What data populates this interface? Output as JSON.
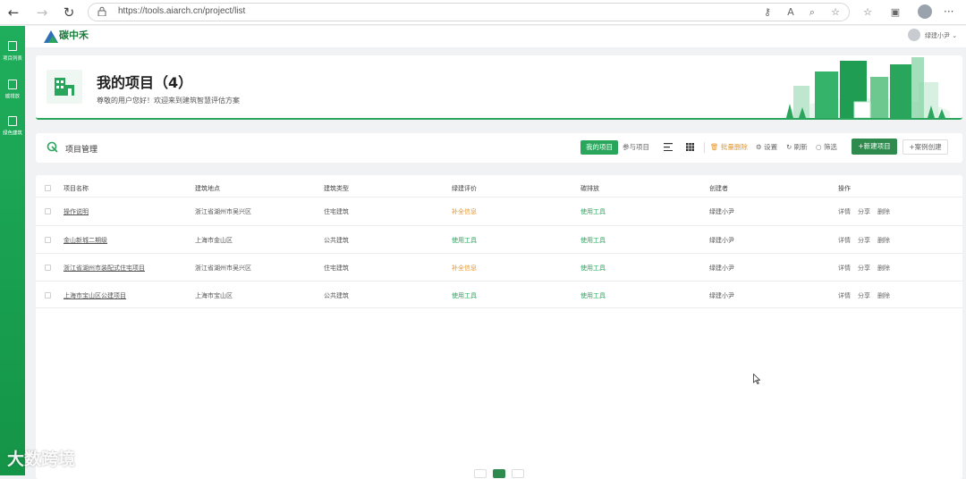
{
  "browser": {
    "url": "https://tools.aiarch.cn/project/list"
  },
  "sidebar": {
    "items": [
      {
        "label": "项目列表"
      },
      {
        "label": "碳排放"
      },
      {
        "label": "绿色建筑"
      }
    ]
  },
  "header": {
    "logo_text": "碳中禾",
    "user_name": "绿建小尹 ⌄"
  },
  "banner": {
    "title": "我的项目（4）",
    "subtitle": "尊敬的用户您好！欢迎来到建筑智慧评估方案"
  },
  "toolbar": {
    "title": "项目管理",
    "tab_mine": "我的项目",
    "tab_joined": "参与项目",
    "batch_delete": "批量删除",
    "settings": "设置",
    "refresh": "刷新",
    "filter": "筛选",
    "new_project": "+新建项目",
    "case_create": "+案例创建"
  },
  "table": {
    "headers": [
      "项目名称",
      "建筑地点",
      "建筑类型",
      "绿建评价",
      "碳排放",
      "创建者",
      "操作"
    ],
    "rows": [
      {
        "name": "操作说明",
        "location": "浙江省湖州市吴兴区",
        "type": "住宅建筑",
        "green": "补全信息",
        "carbon": "使用工具",
        "creator": "绿建小尹"
      },
      {
        "name": "金山新城二期级",
        "location": "上海市金山区",
        "type": "公共建筑",
        "green": "使用工具",
        "carbon": "使用工具",
        "creator": "绿建小尹"
      },
      {
        "name": "浙江省湖州市装配式住宅项目",
        "location": "浙江省湖州市吴兴区",
        "type": "住宅建筑",
        "green": "补全信息",
        "carbon": "使用工具",
        "creator": "绿建小尹"
      },
      {
        "name": "上海市宝山区公建项目",
        "location": "上海市宝山区",
        "type": "公共建筑",
        "green": "使用工具",
        "carbon": "使用工具",
        "creator": "绿建小尹"
      }
    ],
    "ops": {
      "detail": "详情",
      "share": "分享",
      "delete": "删除"
    }
  },
  "watermark": "大数跨境",
  "colors": {
    "accent": "#2aa55c",
    "accent_dark": "#2f8a4e",
    "warning": "#e8962b"
  }
}
